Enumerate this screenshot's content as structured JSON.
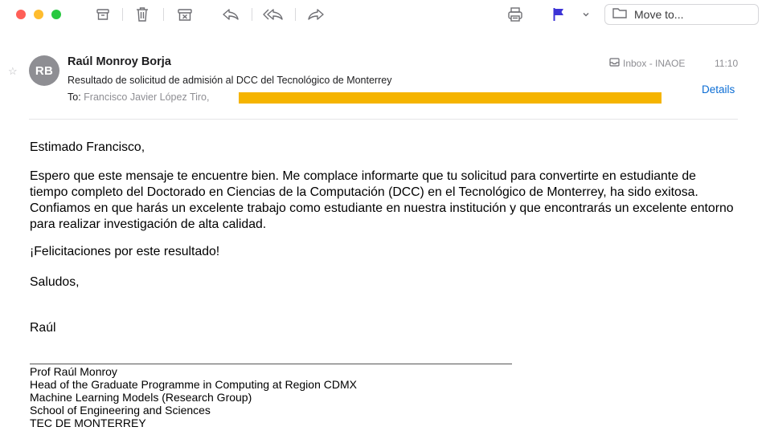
{
  "toolbar": {
    "icons": [
      "archive-icon",
      "trash-icon",
      "junk-icon",
      "reply-icon",
      "reply-all-icon",
      "forward-icon",
      "print-icon",
      "flag-icon",
      "chevron-down-icon",
      "folder-icon"
    ],
    "move_to_label": "Move to...",
    "flag_color": "#3c33d6"
  },
  "message": {
    "avatar_initials": "RB",
    "sender": "Raúl Monroy Borja",
    "subject": "Resultado de solicitud de admisión al DCC del Tecnológico de Monterrey",
    "to_label": "To:",
    "to_value": "Francisco Javier López Tiro,",
    "mailbox": "Inbox - INAOE",
    "time": "11:10",
    "details_label": "Details",
    "redaction_color": "#f5b400"
  },
  "body": {
    "greeting": "Estimado Francisco,",
    "paragraph1": "Espero que este mensaje te encuentre bien. Me complace informarte que tu solicitud para convertirte en estudiante de tiempo completo del Doctorado en Ciencias de la Computación (DCC) en el Tecnológico de Monterrey, ha sido exitosa. Confiamos en que harás un excelente trabajo como estudiante en nuestra institución y que encontrarás un excelente entorno para realizar investigación de alta calidad.",
    "congrats": "¡Felicitaciones por este resultado!",
    "closing": "Saludos,",
    "name": "Raúl"
  },
  "signature": {
    "line1": "Prof Raúl Monroy",
    "line2": "Head of the Graduate Programme in Computing at Region CDMX",
    "line3": "Machine Learning Models (Research Group)",
    "line4": "School of Engineering and Sciences",
    "line5": "TEC DE MONTERREY"
  }
}
